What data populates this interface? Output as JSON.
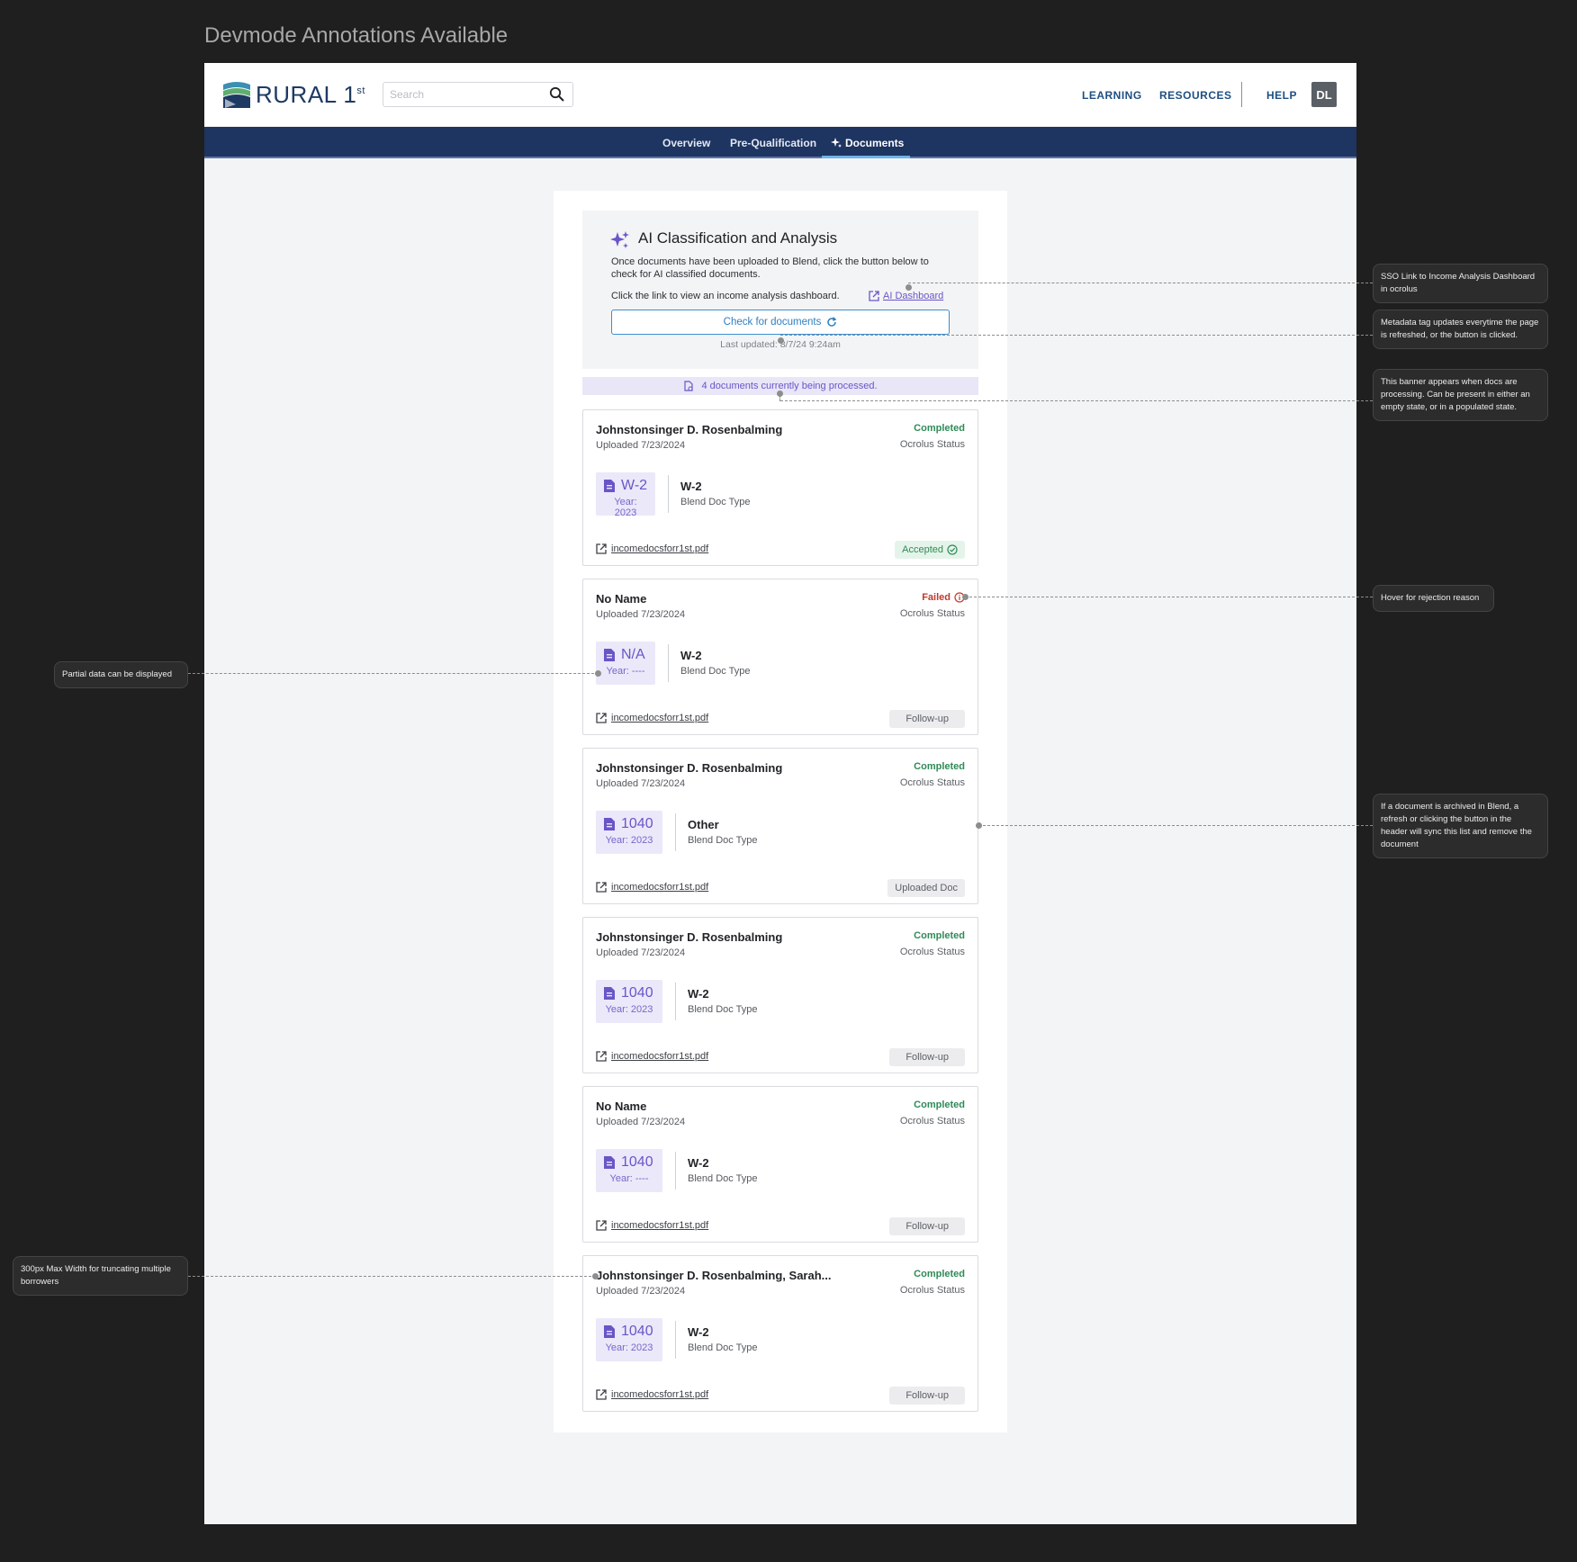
{
  "page_title": "Devmode Annotations Available",
  "header": {
    "logo_text": "RURAL 1",
    "logo_sup": "st",
    "search_placeholder": "Search",
    "links": [
      "LEARNING",
      "RESOURCES",
      "HELP"
    ],
    "avatar": "DL"
  },
  "tabs": [
    {
      "label": "Overview"
    },
    {
      "label": "Pre-Qualification"
    },
    {
      "label": "Documents"
    }
  ],
  "ai": {
    "title": "AI Classification and Analysis",
    "desc": "Once documents have been uploaded to Blend, click the button below to check for AI classified documents.",
    "link_text": "Click the link to view an income analysis dashboard.",
    "dashboard_label": "AI Dashboard",
    "button_label": "Check for documents",
    "last_updated": "Last updated: 8/7/24 9:24am"
  },
  "banner": "4 documents currently being processed.",
  "cards": [
    {
      "name": "Johnstonsinger D. Rosenbalming",
      "uploaded": "Uploaded 7/23/2024",
      "status": "Completed",
      "status_sub": "Ocrolus Status",
      "badge_type": "W-2",
      "badge_year": "Year: 2023",
      "doc_type": "W-2",
      "doc_type_sub": "Blend Doc Type",
      "file": "incomedocsforr1st.pdf",
      "action": "Accepted"
    },
    {
      "name": "No Name",
      "uploaded": "Uploaded 7/23/2024",
      "status": "Failed",
      "status_sub": "Ocrolus Status",
      "badge_type": "N/A",
      "badge_year": "Year: ----",
      "doc_type": "W-2",
      "doc_type_sub": "Blend Doc Type",
      "file": "incomedocsforr1st.pdf",
      "action": "Follow-up"
    },
    {
      "name": "Johnstonsinger D. Rosenbalming",
      "uploaded": "Uploaded 7/23/2024",
      "status": "Completed",
      "status_sub": "Ocrolus Status",
      "badge_type": "1040",
      "badge_year": "Year: 2023",
      "doc_type": "Other",
      "doc_type_sub": "Blend Doc Type",
      "file": "incomedocsforr1st.pdf",
      "action": "Uploaded Doc"
    },
    {
      "name": "Johnstonsinger D. Rosenbalming",
      "uploaded": "Uploaded 7/23/2024",
      "status": "Completed",
      "status_sub": "Ocrolus Status",
      "badge_type": "1040",
      "badge_year": "Year: 2023",
      "doc_type": "W-2",
      "doc_type_sub": "Blend Doc Type",
      "file": "incomedocsforr1st.pdf",
      "action": "Follow-up"
    },
    {
      "name": "No Name",
      "uploaded": "Uploaded 7/23/2024",
      "status": "Completed",
      "status_sub": "Ocrolus Status",
      "badge_type": "1040",
      "badge_year": "Year: ----",
      "doc_type": "W-2",
      "doc_type_sub": "Blend Doc Type",
      "file": "incomedocsforr1st.pdf",
      "action": "Follow-up"
    },
    {
      "name": "Johnstonsinger D. Rosenbalming, Sarah...",
      "uploaded": "Uploaded 7/23/2024",
      "status": "Completed",
      "status_sub": "Ocrolus Status",
      "badge_type": "1040",
      "badge_year": "Year: 2023",
      "doc_type": "W-2",
      "doc_type_sub": "Blend Doc Type",
      "file": "incomedocsforr1st.pdf",
      "action": "Follow-up"
    }
  ],
  "annotations": [
    "SSO Link to Income Analysis Dashboard in ocrolus",
    "Metadata tag updates everytime the page is refreshed, or the button is clicked.",
    "This banner appears when docs are processing. Can be present in either an empty state, or in a populated state.",
    "Hover for rejection reason",
    "If a document is archived in Blend, a refresh or clicking the button in the header will sync this list and remove the document",
    "Partial data can be displayed",
    "300px Max Width for truncating multiple borrowers"
  ],
  "colors": {
    "accent": "#6a55c8",
    "nav": "#1e3461",
    "success": "#2e8b57",
    "error": "#c0392b"
  }
}
